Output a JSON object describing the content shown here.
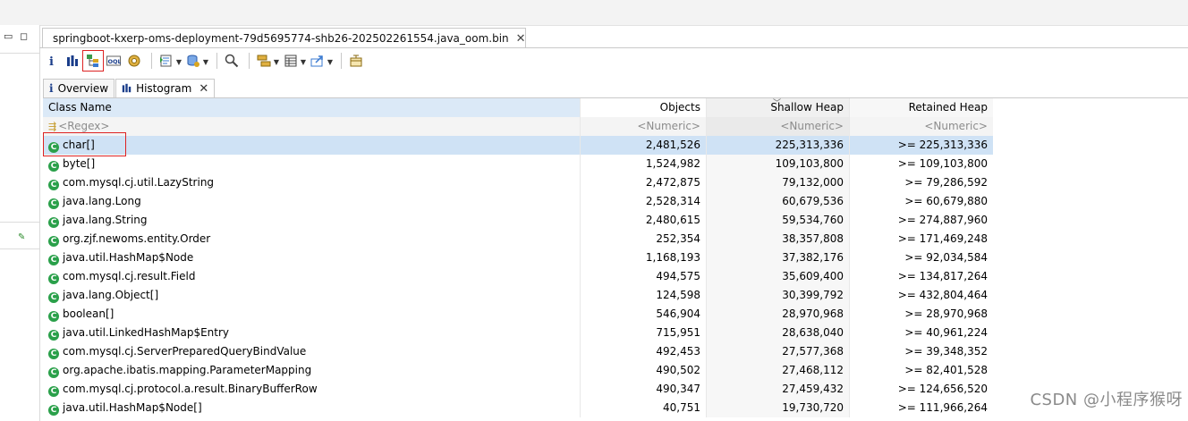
{
  "editor_tab": {
    "title": "springboot-kxerp-oms-deployment-79d5695774-shb26-202502261554.java_oom.bin"
  },
  "sub_tabs": [
    {
      "label": "Overview",
      "icon": "info-icon"
    },
    {
      "label": "Histogram",
      "icon": "histogram-icon"
    }
  ],
  "toolbar": {
    "icons": [
      "info-icon",
      "histogram-icon",
      "dominator-tree-icon",
      "oql-icon",
      "thread-overview-icon",
      "run-report-icon",
      "query-browser-icon",
      "search-icon",
      "group-by-icon",
      "calculate-retained-icon",
      "export-icon",
      "compare-icon"
    ]
  },
  "table": {
    "columns": [
      "Class Name",
      "Objects",
      "Shallow Heap",
      "Retained Heap"
    ],
    "filters": [
      "<Regex>",
      "<Numeric>",
      "<Numeric>",
      "<Numeric>"
    ],
    "rows": [
      {
        "name": "char[]",
        "objects": "2,481,526",
        "shallow": "225,313,336",
        "retained": ">= 225,313,336"
      },
      {
        "name": "byte[]",
        "objects": "1,524,982",
        "shallow": "109,103,800",
        "retained": ">= 109,103,800"
      },
      {
        "name": "com.mysql.cj.util.LazyString",
        "objects": "2,472,875",
        "shallow": "79,132,000",
        "retained": ">= 79,286,592"
      },
      {
        "name": "java.lang.Long",
        "objects": "2,528,314",
        "shallow": "60,679,536",
        "retained": ">= 60,679,880"
      },
      {
        "name": "java.lang.String",
        "objects": "2,480,615",
        "shallow": "59,534,760",
        "retained": ">= 274,887,960"
      },
      {
        "name": "org.zjf.newoms.entity.Order",
        "objects": "252,354",
        "shallow": "38,357,808",
        "retained": ">= 171,469,248"
      },
      {
        "name": "java.util.HashMap$Node",
        "objects": "1,168,193",
        "shallow": "37,382,176",
        "retained": ">= 92,034,584"
      },
      {
        "name": "com.mysql.cj.result.Field",
        "objects": "494,575",
        "shallow": "35,609,400",
        "retained": ">= 134,817,264"
      },
      {
        "name": "java.lang.Object[]",
        "objects": "124,598",
        "shallow": "30,399,792",
        "retained": ">= 432,804,464"
      },
      {
        "name": "boolean[]",
        "objects": "546,904",
        "shallow": "28,970,968",
        "retained": ">= 28,970,968"
      },
      {
        "name": "java.util.LinkedHashMap$Entry",
        "objects": "715,951",
        "shallow": "28,638,040",
        "retained": ">= 40,961,224"
      },
      {
        "name": "com.mysql.cj.ServerPreparedQueryBindValue",
        "objects": "492,453",
        "shallow": "27,577,368",
        "retained": ">= 39,348,352"
      },
      {
        "name": "org.apache.ibatis.mapping.ParameterMapping",
        "objects": "490,502",
        "shallow": "27,468,112",
        "retained": ">= 82,401,528"
      },
      {
        "name": "com.mysql.cj.protocol.a.result.BinaryBufferRow",
        "objects": "490,347",
        "shallow": "27,459,432",
        "retained": ">= 124,656,520"
      },
      {
        "name": "java.util.HashMap$Node[]",
        "objects": "40,751",
        "shallow": "19,730,720",
        "retained": ">= 111,966,264"
      }
    ]
  },
  "watermark": "CSDN @小程序猴呀",
  "colors": {
    "selection": "#cfe2f5",
    "class_icon": "#2aa04a",
    "highlight_box": "#dd2222"
  }
}
